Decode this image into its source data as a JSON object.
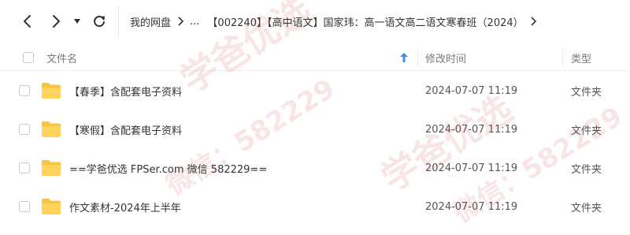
{
  "toolbar": {
    "back_icon": "chevron-left-icon",
    "forward_icon": "chevron-right-icon",
    "dropdown_icon": "caret-down-icon",
    "refresh_icon": "refresh-icon"
  },
  "breadcrumb": {
    "root": "我的网盘",
    "ellipsis": "...",
    "current": "【002240】【高中语文】国家玮：高一语文高二语文寒春班（2024）"
  },
  "columns": {
    "name": "文件名",
    "modified": "修改时间",
    "type": "类型",
    "sort_icon": "arrow-up-icon"
  },
  "files": [
    {
      "name": "【春季】含配套电子资料",
      "modified": "2024-07-07 11:19",
      "type": "文件夹"
    },
    {
      "name": "【寒假】含配套电子资料",
      "modified": "2024-07-07 11:19",
      "type": "文件夹"
    },
    {
      "name": "==学爸优选 FPSer.com 微信 582229==",
      "modified": "2024-07-07 11:19",
      "type": "文件夹"
    },
    {
      "name": "作文素材-2024年上半年",
      "modified": "2024-07-07 11:19",
      "type": "文件夹"
    }
  ],
  "watermark": {
    "line1": "学爸优选",
    "line2": "微信：582229"
  },
  "colors": {
    "folder": "#f7c542",
    "sort_arrow": "#3d8ef7",
    "watermark": "#c83c3c"
  }
}
